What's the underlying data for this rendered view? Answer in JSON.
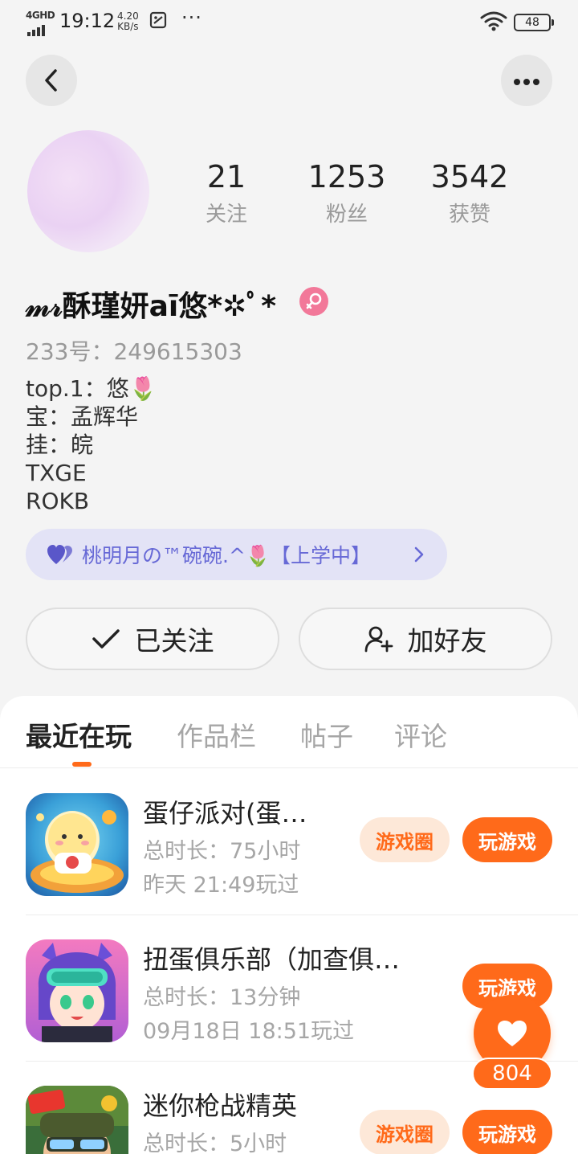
{
  "status_bar": {
    "network": "4GHD",
    "time": "19:12",
    "speed_value": "4.20",
    "speed_unit": "KB/s",
    "more": "···",
    "battery": "48"
  },
  "profile": {
    "stats": [
      {
        "value": "21",
        "label": "关注"
      },
      {
        "value": "1253",
        "label": "粉丝"
      },
      {
        "value": "3542",
        "label": "获赞"
      }
    ],
    "nickname": "𝓂𝓇酥瑾妍aī悠*✲ﾟ*",
    "id_line": "233号：249615303",
    "bio_lines": [
      "top.1：悠🌷",
      "宝：孟辉华",
      "挂：皖",
      "TXGE",
      "ROKB"
    ],
    "partner": "桃明月の™碗碗.^🌷【上学中】"
  },
  "actions": {
    "follow": "已关注",
    "add_friend": "加好友"
  },
  "tabs": [
    "最近在玩",
    "作品栏",
    "帖子",
    "评论"
  ],
  "games": [
    {
      "title": "蛋仔派对(蛋…",
      "duration": "总时长：75小时",
      "last_played": "昨天 21:49玩过",
      "circle_label": "游戏圈",
      "play_label": "玩游戏"
    },
    {
      "title": "扭蛋俱乐部（加查俱…",
      "duration": "总时长：13分钟",
      "last_played": "09月18日 18:51玩过",
      "play_label": "玩游戏"
    },
    {
      "title": "迷你枪战精英",
      "duration": "总时长：5小时",
      "circle_label": "游戏圈",
      "play_label": "玩游戏"
    }
  ],
  "likes": "804",
  "colors": {
    "accent": "#ff6a1a",
    "partner_text": "#6769d6",
    "gender_badge": "#f27899"
  }
}
